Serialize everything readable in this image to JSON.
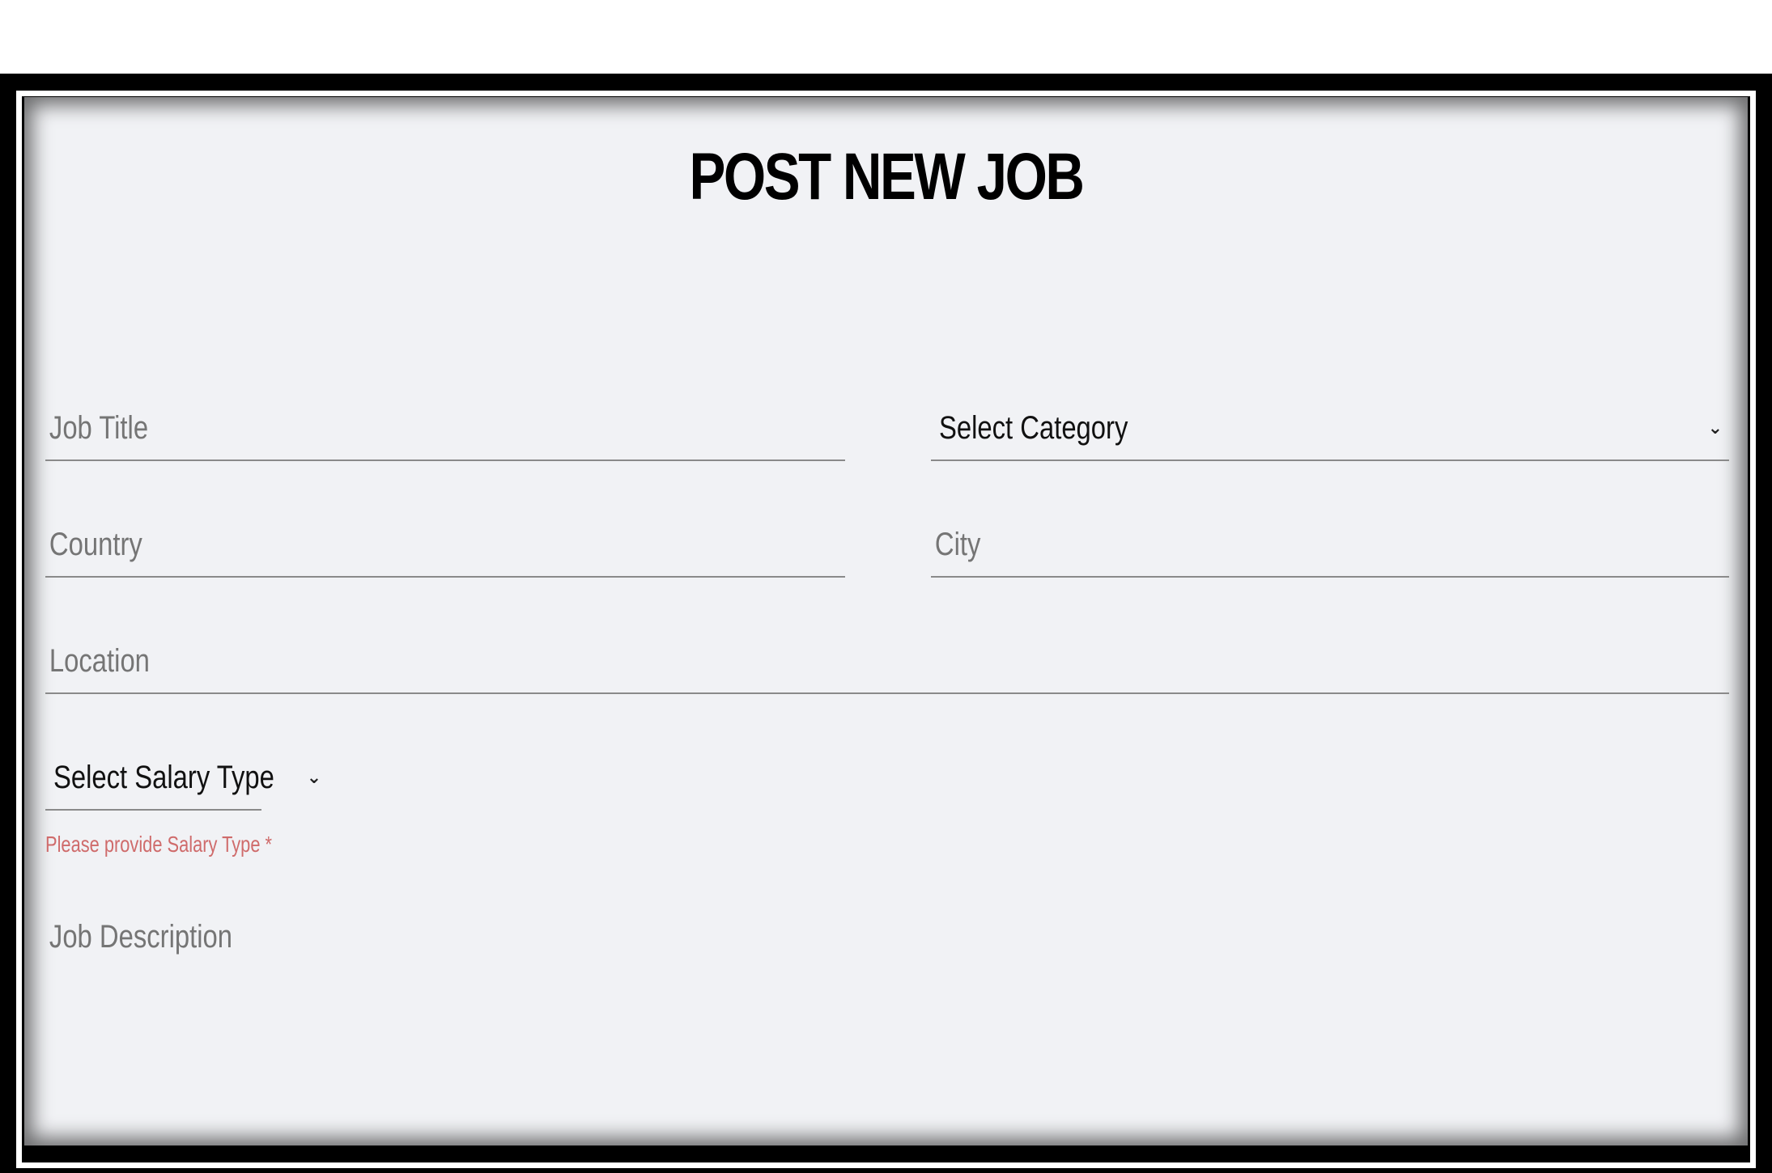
{
  "page": {
    "title": "POST NEW JOB"
  },
  "form": {
    "job_title": {
      "placeholder": "Job Title",
      "value": ""
    },
    "category": {
      "selected": "Select Category",
      "icon": "chevron-down-icon"
    },
    "country": {
      "placeholder": "Country",
      "value": ""
    },
    "city": {
      "placeholder": "City",
      "value": ""
    },
    "location": {
      "placeholder": "Location",
      "value": ""
    },
    "salary_type": {
      "selected": "Select Salary Type",
      "icon": "chevron-down-icon",
      "error": "Please provide Salary Type *"
    },
    "job_description": {
      "placeholder": "Job Description",
      "value": ""
    }
  },
  "colors": {
    "panel_background": "#f1f2f5",
    "error": "#cf6b6b",
    "underline": "#8a8a8a"
  }
}
